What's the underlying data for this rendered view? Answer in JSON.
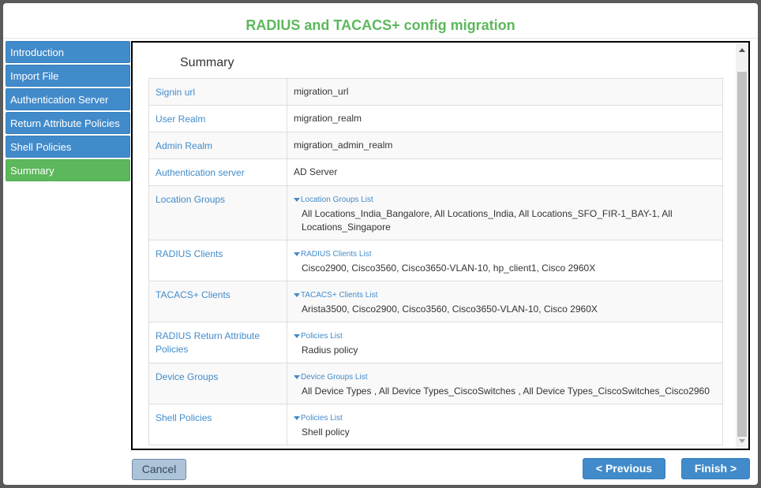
{
  "modal": {
    "title": "RADIUS and TACACS+ config migration"
  },
  "nav": {
    "items": [
      {
        "label": "Introduction"
      },
      {
        "label": "Import File"
      },
      {
        "label": "Authentication Server"
      },
      {
        "label": "Return Attribute Policies"
      },
      {
        "label": "Shell Policies"
      },
      {
        "label": "Summary",
        "active": true
      }
    ]
  },
  "summary": {
    "heading": "Summary",
    "rows": [
      {
        "key": "Signin url",
        "value": "migration_url"
      },
      {
        "key": "User Realm",
        "value": "migration_realm"
      },
      {
        "key": "Admin Realm",
        "value": "migration_admin_realm"
      },
      {
        "key": "Authentication server",
        "value": "AD Server"
      },
      {
        "key": "Location Groups",
        "toggle": "Location Groups List",
        "value": "All Locations_India_Bangalore, All Locations_India, All Locations_SFO_FIR-1_BAY-1, All Locations_Singapore"
      },
      {
        "key": "RADIUS Clients",
        "toggle": "RADIUS Clients List",
        "value": "Cisco2900, Cisco3560, Cisco3650-VLAN-10, hp_client1, Cisco 2960X"
      },
      {
        "key": "TACACS+ Clients",
        "toggle": "TACACS+ Clients List",
        "value": "Arista3500, Cisco2900, Cisco3560, Cisco3650-VLAN-10, Cisco 2960X"
      },
      {
        "key": "RADIUS Return Attribute Policies",
        "toggle": "Policies List",
        "value": "Radius policy"
      },
      {
        "key": "Device Groups",
        "toggle": "Device Groups List",
        "value": "All Device Types , All Device Types_CiscoSwitches , All Device Types_CiscoSwitches_Cisco2960"
      },
      {
        "key": "Shell Policies",
        "toggle": "Policies List",
        "value": "Shell policy"
      }
    ]
  },
  "footer": {
    "cancel_label": "Cancel",
    "previous_label": "< Previous",
    "finish_label": "Finish >"
  },
  "colors": {
    "title_green": "#5cb85c",
    "nav_blue": "#428bca",
    "nav_active_green": "#5cb85c",
    "link_blue": "#428bca"
  },
  "icons": {
    "toggle": "caret-down-icon",
    "scroll_up": "arrow-up-icon",
    "scroll_down": "arrow-down-icon"
  }
}
